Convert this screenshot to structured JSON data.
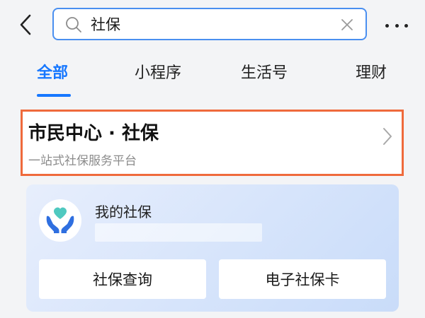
{
  "header": {
    "search": {
      "value": "社保"
    }
  },
  "tabs": [
    {
      "label": "全部",
      "active": true
    },
    {
      "label": "小程序",
      "active": false
    },
    {
      "label": "生活号",
      "active": false
    },
    {
      "label": "理财",
      "active": false
    }
  ],
  "result": {
    "title": "市民中心 · 社保",
    "subtitle": "一站式社保服务平台"
  },
  "service": {
    "title": "我的社保",
    "buttons": [
      {
        "label": "社保查询"
      },
      {
        "label": "电子社保卡"
      }
    ]
  },
  "colors": {
    "accent": "#1677ff",
    "highlight_border": "#ef6a3c",
    "search_border": "#4a8ff0",
    "logo_heart": "#4fc9c0",
    "logo_hands": "#2f6fe0"
  },
  "icons": {
    "back": "chevron-left-icon",
    "search": "search-icon",
    "clear": "close-icon",
    "more": "more-dots-icon",
    "result_arrow": "chevron-right-icon",
    "service_logo": "heart-hands-icon"
  }
}
